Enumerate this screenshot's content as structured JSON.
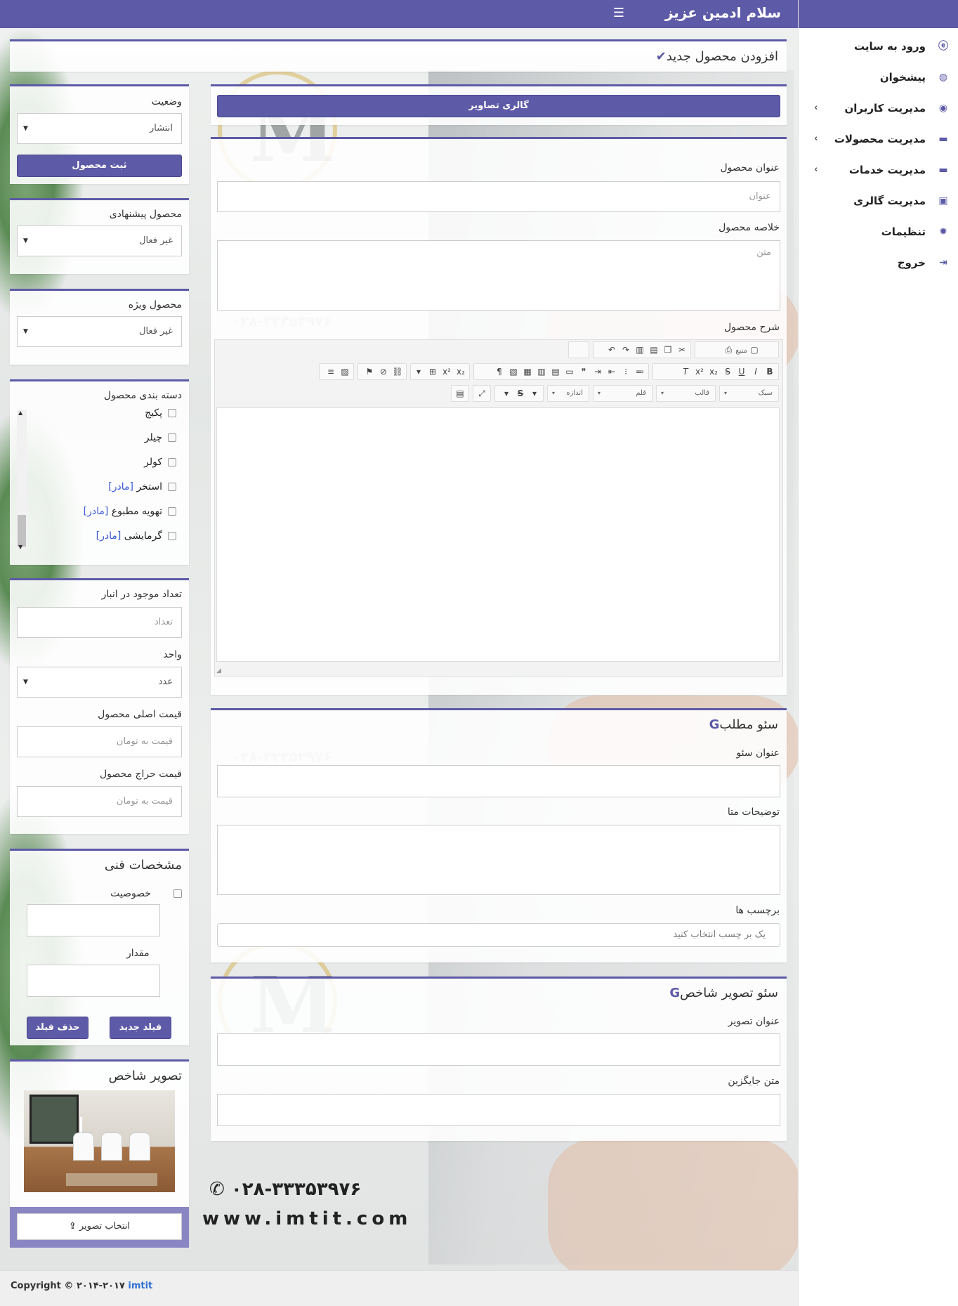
{
  "header": {
    "brand": "سلام ادمین عزیز",
    "menu_icon": "☰"
  },
  "sidebar": {
    "items": [
      {
        "label": "ورود به سایت",
        "icon": "ie-icon"
      },
      {
        "label": "پیشخوان",
        "icon": "dashboard-icon"
      },
      {
        "label": "مدیریت کاربران",
        "icon": "user-icon",
        "has_submenu": true
      },
      {
        "label": "مدیریت محصولات",
        "icon": "cart-icon",
        "has_submenu": true
      },
      {
        "label": "مدیریت خدمات",
        "icon": "cart-icon",
        "has_submenu": true
      },
      {
        "label": "مدیریت گالری",
        "icon": "image-icon"
      },
      {
        "label": "تنظیمات",
        "icon": "gear-icon"
      },
      {
        "label": "خروج",
        "icon": "logout-icon"
      }
    ]
  },
  "page": {
    "title": "افزودن محصول جدید",
    "title_icon": "✔"
  },
  "gallery_button": "گالری تصاویر",
  "product": {
    "title_label": "عنوان محصول",
    "title_placeholder": "عنوان",
    "summary_label": "خلاصه محصول",
    "summary_placeholder": "متن",
    "desc_label": "شرح محصول",
    "editor": {
      "source_label": "منبع",
      "styles_label": "سبک",
      "format_label": "قالب",
      "font_label": "قلم",
      "size_label": "اندازه"
    }
  },
  "seo": {
    "title": "سئو مطلب",
    "seo_title_label": "عنوان سئو",
    "meta_label": "توضیحات متا",
    "tags_label": "برچسب ها",
    "tags_placeholder": "یک بر چسب انتخاب کنید"
  },
  "seo_image": {
    "title": "سئو تصویر شاخص",
    "image_title_label": "عنوان تصویر",
    "alt_label": "متن جایگزین"
  },
  "status": {
    "label": "وضعیت",
    "value": "انتشار",
    "submit": "ثبت محصول"
  },
  "suggested": {
    "label": "محصول پیشنهادی",
    "value": "غیر فعال"
  },
  "special": {
    "label": "محصول ویژه",
    "value": "غیر فعال"
  },
  "categories": {
    "label": "دسته بندی محصول",
    "items": [
      {
        "name": "پکیج",
        "tag": ""
      },
      {
        "name": "چیلر",
        "tag": ""
      },
      {
        "name": "کولر",
        "tag": ""
      },
      {
        "name": "استخر",
        "tag": "[مادر]"
      },
      {
        "name": "تهویه مطبوع",
        "tag": "[مادر]"
      },
      {
        "name": "گرمایشی",
        "tag": "[مادر]"
      }
    ]
  },
  "inventory": {
    "stock_label": "تعداد موجود در انبار",
    "stock_placeholder": "تعداد",
    "unit_label": "واحد",
    "unit_value": "عدد",
    "price_label": "قیمت اصلی محصول",
    "price_placeholder": "قیمت به تومان",
    "sale_label": "قیمت حراج محصول",
    "sale_placeholder": "قیمت به تومان"
  },
  "specs": {
    "title": "مشخصات فنی",
    "feature_label": "خصوصیت",
    "value_label": "مقدار",
    "new_field": "فیلد جدید",
    "delete_field": "حذف فیلد"
  },
  "featured_image": {
    "title": "تصویر شاخص",
    "select_button": "انتخاب تصویر"
  },
  "watermark": {
    "phone": "۰۲۸-۳۳۳۵۳۹۷۶",
    "site": "www.imtit.com",
    "logo_letter": "M"
  },
  "footer": {
    "copyright": "Copyright © ۲۰۱۴-۲۰۱۷",
    "link": "imtit"
  },
  "colors": {
    "accent": "#5d5aa7",
    "mother_tag": "#3b5bd9",
    "link": "#2f6fd0"
  }
}
